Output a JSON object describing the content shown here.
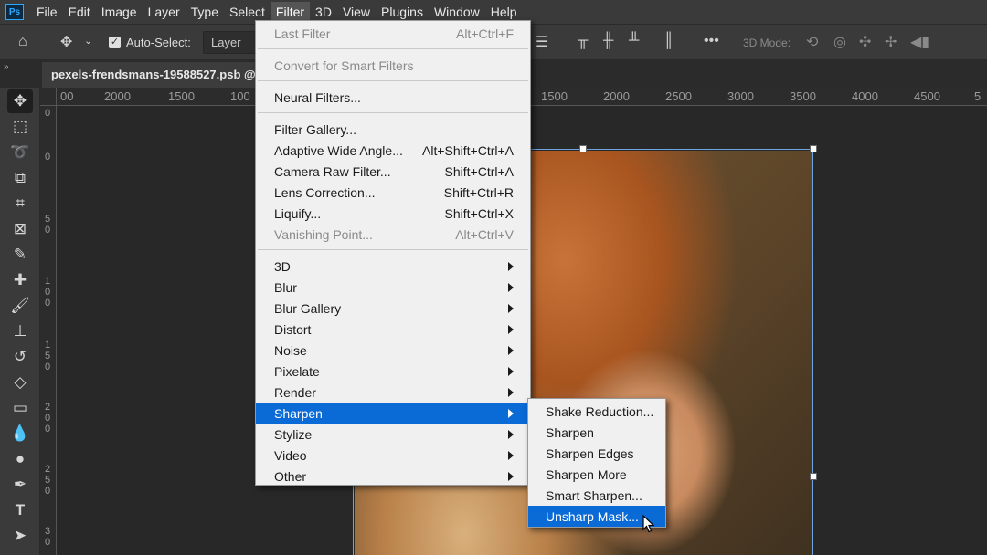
{
  "menubar": {
    "app_icon": "Ps",
    "items": [
      "File",
      "Edit",
      "Image",
      "Layer",
      "Type",
      "Select",
      "Filter",
      "3D",
      "View",
      "Plugins",
      "Window",
      "Help"
    ],
    "active": "Filter"
  },
  "options": {
    "home_icon": "home-icon",
    "auto_select_label": "Auto-Select:",
    "auto_select_checked": true,
    "layer_value": "Layer",
    "mode3d_label": "3D Mode:"
  },
  "document": {
    "tab_title": "pexels-frendsmans-19588527.psb @"
  },
  "ruler": {
    "top_labels": [
      "00",
      "2000",
      "1500",
      "100",
      "1500",
      "2000",
      "2500",
      "3000",
      "3500",
      "4000",
      "4500",
      "5"
    ],
    "left_labels": [
      "0",
      "0",
      "5\n0",
      "1\n0\n0",
      "1\n5\n0",
      "2\n0\n0",
      "2\n5\n0",
      "3\n0"
    ]
  },
  "filter_menu": {
    "items": [
      {
        "label": "Last Filter",
        "shortcut": "Alt+Ctrl+F",
        "disabled": true
      },
      {
        "label": "Convert for Smart Filters",
        "disabled": true
      },
      {
        "label": "Neural Filters..."
      },
      {
        "label": "Filter Gallery..."
      },
      {
        "label": "Adaptive Wide Angle...",
        "shortcut": "Alt+Shift+Ctrl+A"
      },
      {
        "label": "Camera Raw Filter...",
        "shortcut": "Shift+Ctrl+A"
      },
      {
        "label": "Lens Correction...",
        "shortcut": "Shift+Ctrl+R"
      },
      {
        "label": "Liquify...",
        "shortcut": "Shift+Ctrl+X"
      },
      {
        "label": "Vanishing Point...",
        "shortcut": "Alt+Ctrl+V",
        "disabled": true
      },
      {
        "label": "3D",
        "submenu": true
      },
      {
        "label": "Blur",
        "submenu": true
      },
      {
        "label": "Blur Gallery",
        "submenu": true
      },
      {
        "label": "Distort",
        "submenu": true
      },
      {
        "label": "Noise",
        "submenu": true
      },
      {
        "label": "Pixelate",
        "submenu": true
      },
      {
        "label": "Render",
        "submenu": true
      },
      {
        "label": "Sharpen",
        "submenu": true,
        "highlighted": true
      },
      {
        "label": "Stylize",
        "submenu": true
      },
      {
        "label": "Video",
        "submenu": true
      },
      {
        "label": "Other",
        "submenu": true
      }
    ]
  },
  "sharpen_submenu": {
    "items": [
      "Shake Reduction...",
      "Sharpen",
      "Sharpen Edges",
      "Sharpen More",
      "Smart Sharpen...",
      "Unsharp Mask..."
    ],
    "highlighted": "Unsharp Mask..."
  },
  "colors": {
    "highlight": "#0a6ad6",
    "menu_bg": "#f0f0f0",
    "ui_bg": "#3a3a3a",
    "canvas_bg": "#282828"
  }
}
